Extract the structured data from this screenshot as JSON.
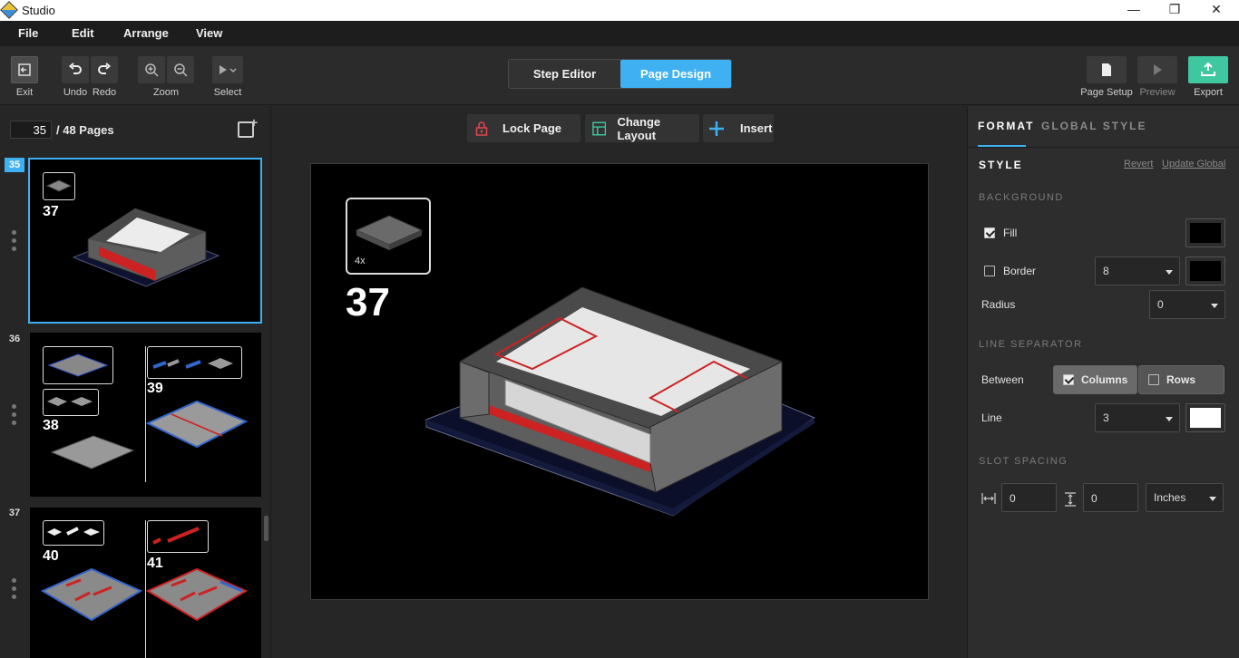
{
  "window": {
    "title": "Studio"
  },
  "menu": [
    "File",
    "Edit",
    "Arrange",
    "View"
  ],
  "toolbar": {
    "exit": "Exit",
    "undo": "Undo",
    "redo": "Redo",
    "zoom": "Zoom",
    "select": "Select",
    "step_editor": "Step Editor",
    "page_design": "Page Design",
    "page_setup": "Page Setup",
    "preview": "Preview",
    "export": "Export"
  },
  "pages": {
    "current": "35",
    "total_label": "/ 48 Pages",
    "thumbs": [
      {
        "num": "35",
        "steps": [
          "37"
        ]
      },
      {
        "num": "36",
        "steps": [
          "38",
          "39"
        ]
      },
      {
        "num": "37",
        "steps": [
          "40",
          "41"
        ]
      }
    ]
  },
  "canvas_toolbar": {
    "lock": "Lock Page",
    "layout": "Change Layout",
    "insert": "Insert"
  },
  "canvas": {
    "step_number": "37",
    "part_count": "4x"
  },
  "format": {
    "tab_format": "FORMAT",
    "tab_global": "GLOBAL STYLE",
    "style": "STYLE",
    "revert": "Revert",
    "update_global": "Update Global",
    "background": "BACKGROUND",
    "fill_label": "Fill",
    "fill_checked": true,
    "fill_color": "#000000",
    "border_label": "Border",
    "border_checked": false,
    "border_width": "8",
    "border_color": "#000000",
    "radius_label": "Radius",
    "radius_value": "0",
    "line_separator": "LINE SEPARATOR",
    "between_label": "Between",
    "columns": "Columns",
    "columns_checked": true,
    "rows": "Rows",
    "rows_checked": false,
    "line_label": "Line",
    "line_width": "3",
    "line_color": "#ffffff",
    "slot_spacing": "SLOT SPACING",
    "h_spacing": "0",
    "v_spacing": "0",
    "unit": "Inches"
  },
  "colors": {
    "accent": "#3fb1f2",
    "lock_icon": "#e0474c",
    "layout_icon": "#3fc7a0",
    "insert_icon": "#3fb1f2",
    "export_icon": "#3fc7a0"
  }
}
